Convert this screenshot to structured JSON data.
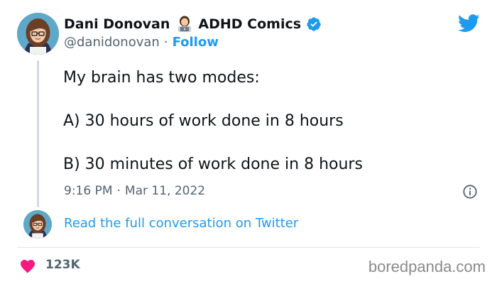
{
  "author": {
    "display_name": "Dani Donovan",
    "emoji_name": "woman-technologist-emoji",
    "brand": "ADHD Comics",
    "verified": true,
    "handle": "@danidonovan",
    "separator": "·",
    "follow_label": "Follow"
  },
  "tweet": {
    "lines": [
      "My brain has two modes:",
      "A) 30 hours of work done in 8 hours",
      "B) 30 minutes of work done in 8 hours"
    ],
    "time": "9:16 PM",
    "separator": "·",
    "date": "Mar 11, 2022"
  },
  "conversation_link": "Read the full conversation on Twitter",
  "engagement": {
    "likes": "123K"
  },
  "watermark": "boredpanda.com",
  "colors": {
    "twitter_blue": "#1d9bf0",
    "heart_red": "#f91880",
    "secondary_text": "#536471",
    "primary_text": "#0f1419"
  }
}
